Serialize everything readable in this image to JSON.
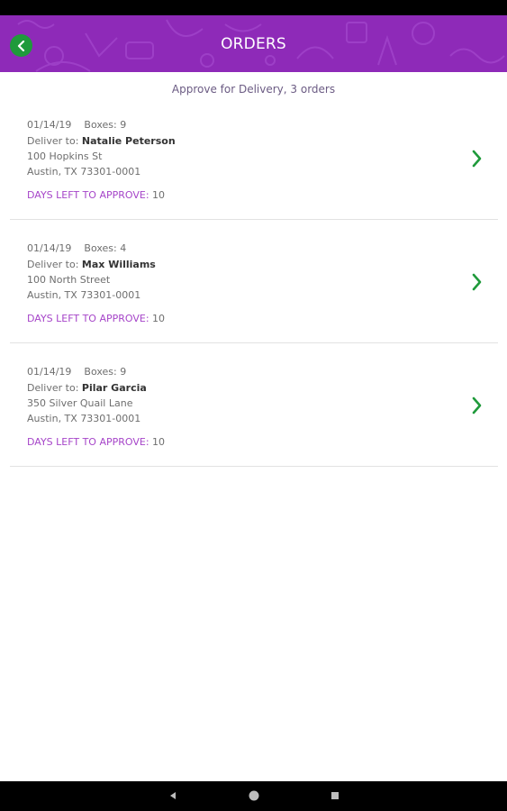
{
  "header": {
    "title": "ORDERS"
  },
  "subtitle": "Approve for Delivery, 3 orders",
  "orders": [
    {
      "date": "01/14/19",
      "boxes_label": "Boxes: 9",
      "deliver_label": "Deliver to:",
      "name": "Natalie Peterson",
      "street": "100 Hopkins St",
      "city": "Austin, TX 73301-0001",
      "days_label": "DAYS LEFT TO APPROVE:",
      "days_value": "10"
    },
    {
      "date": "01/14/19",
      "boxes_label": "Boxes: 4",
      "deliver_label": "Deliver to:",
      "name": "Max Williams",
      "street": "100 North Street",
      "city": "Austin, TX 73301-0001",
      "days_label": "DAYS LEFT TO APPROVE:",
      "days_value": "10"
    },
    {
      "date": "01/14/19",
      "boxes_label": "Boxes: 9",
      "deliver_label": "Deliver to:",
      "name": "Pilar Garcia",
      "street": "350 Silver Quail Lane",
      "city": "Austin, TX 73301-0001",
      "days_label": "DAYS LEFT TO APPROVE:",
      "days_value": "10"
    }
  ],
  "colors": {
    "header": "#8e2ab8",
    "accent_green": "#1f9a3b",
    "days_label": "#a645c9"
  },
  "icons": {
    "back": "chevron-left-icon",
    "row": "chevron-right-icon",
    "nav": [
      "back-triangle-icon",
      "home-circle-icon",
      "recents-square-icon"
    ]
  }
}
